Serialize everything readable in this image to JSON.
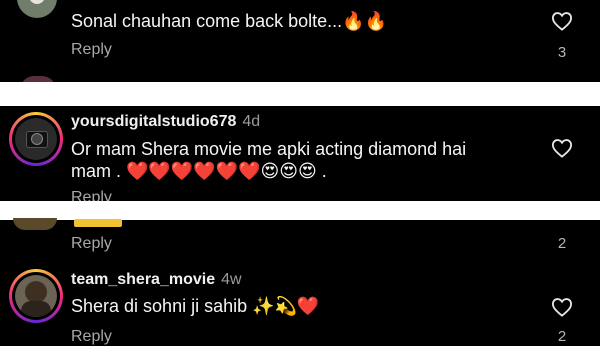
{
  "comments": [
    {
      "text": "Sonal chauhan come back bolte...🔥🔥",
      "reply_label": "Reply",
      "like_count": "3"
    },
    {
      "username": "yoursdigitalstudio678",
      "age": "4d",
      "text_line1": "Or mam Shera movie me apki acting diamond hai",
      "text_line2": "mam . ❤️❤️❤️❤️❤️❤️😍😍😍 .",
      "reply_label": "Reply"
    },
    {
      "reply_label": "Reply",
      "like_count": "2"
    },
    {
      "username": "team_shera_movie",
      "age": "4w",
      "text": "Shera di sohni ji sahib ✨💫❤️",
      "reply_label": "Reply",
      "like_count": "2"
    }
  ],
  "icons": {
    "like": "heart-outline-icon"
  },
  "colors": {
    "background": "#000000",
    "secondary_text": "#a8a8a8",
    "story_ring": "#ee2a7b"
  }
}
